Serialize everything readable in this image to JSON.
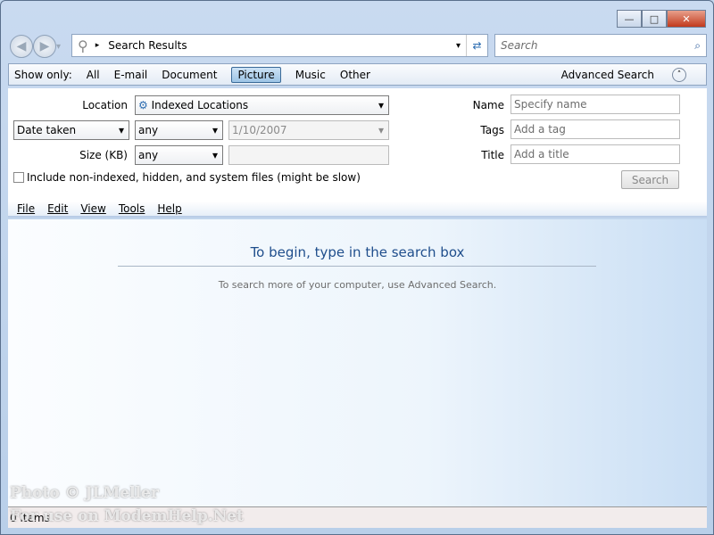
{
  "window": {
    "minimize": "—",
    "maximize": "□",
    "close": "✕"
  },
  "nav": {
    "back_icon": "◀",
    "forward_icon": "▶",
    "dropdown": "▾"
  },
  "address": {
    "path": "Search Results",
    "sep": "▸",
    "dropdown": "▾",
    "refresh": "⇄"
  },
  "search": {
    "placeholder": "Search",
    "icon": "⌕"
  },
  "show_only": {
    "label": "Show only:",
    "items": [
      "All",
      "E-mail",
      "Document",
      "Picture",
      "Music",
      "Other"
    ],
    "selected": "Picture",
    "advanced": "Advanced Search",
    "chev": "˄"
  },
  "filters": {
    "location_label": "Location",
    "location_value": "Indexed Locations",
    "date_field": "Date taken",
    "date_op": "any",
    "date_value": "1/10/2007",
    "size_label": "Size (KB)",
    "size_op": "any",
    "include_label": "Include non-indexed, hidden, and system files (might be slow)",
    "name_label": "Name",
    "name_placeholder": "Specify name",
    "tags_label": "Tags",
    "tags_placeholder": "Add a tag",
    "title_label": "Title",
    "title_placeholder": "Add a title",
    "search_button": "Search",
    "arrow": "▾"
  },
  "menu": [
    "File",
    "Edit",
    "View",
    "Tools",
    "Help"
  ],
  "main": {
    "heading": "To begin, type in the search box",
    "subtext": "To search more of your computer, use Advanced Search."
  },
  "watermark": {
    "line1": "Photo © JLMeller",
    "line2": "For use on ModemHelp.Net"
  },
  "status": {
    "items": "0 items"
  }
}
